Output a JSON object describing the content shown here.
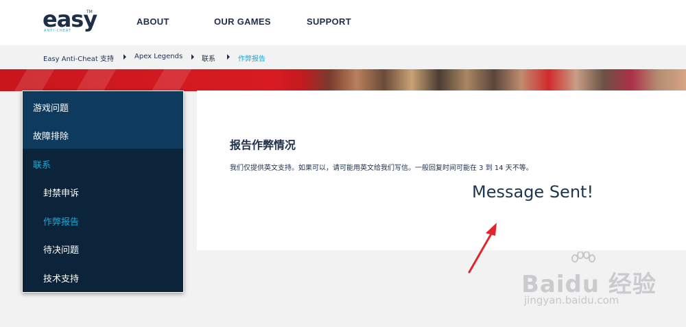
{
  "header": {
    "logo_text": "easy",
    "logo_tm": "TM",
    "logo_subtext": "ANTI-CHEAT",
    "nav": [
      "ABOUT",
      "OUR GAMES",
      "SUPPORT"
    ]
  },
  "breadcrumb": [
    "Easy Anti-Cheat 支持",
    "Apex Legends",
    "联系",
    "作弊报告"
  ],
  "sidebar": {
    "items": [
      "游戏问题",
      "故障排除",
      "联系",
      "封禁申诉",
      "作弊报告",
      "待决问题",
      "技术支持"
    ],
    "selected_index": 4
  },
  "content": {
    "title": "报告作弊情况",
    "description": "我们仅提供英文支持。如果可以，请可能用英文给我们写信。一般回复时间可能在 3 到 14 天不等。",
    "message": "Message Sent!"
  },
  "watermark": {
    "brand": "Baidu 经验",
    "url": "jingyan.baidu.com"
  },
  "colors": {
    "navy": "#1e2f4a",
    "accent": "#1aa9d6",
    "sidebar_bg": "#0c2439",
    "sidebar_top": "#0e3a5e",
    "arrow": "#e0262a"
  }
}
